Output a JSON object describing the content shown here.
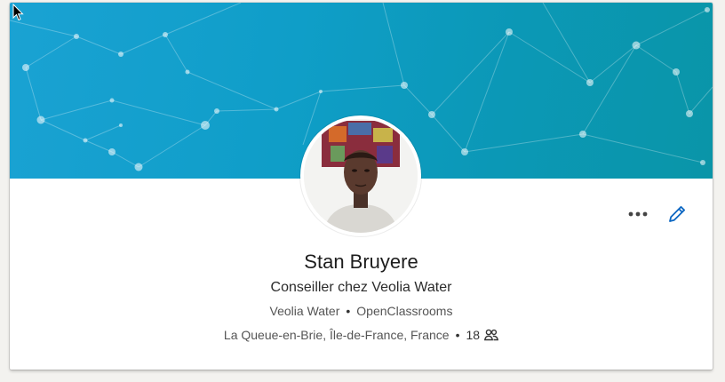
{
  "profile": {
    "name": "Stan Bruyere",
    "headline": "Conseiller chez Veolia Water",
    "company_1": "Veolia Water",
    "company_2": "OpenClassrooms",
    "location": "La Queue-en-Brie, Île-de-France, France",
    "connections": "18"
  },
  "icons": {
    "more": "more-dots-icon",
    "edit": "pencil-icon",
    "connections": "people-icon"
  },
  "colors": {
    "banner_start": "#1aa2d3",
    "banner_end": "#0a95a8",
    "accent": "#0a66c2"
  }
}
